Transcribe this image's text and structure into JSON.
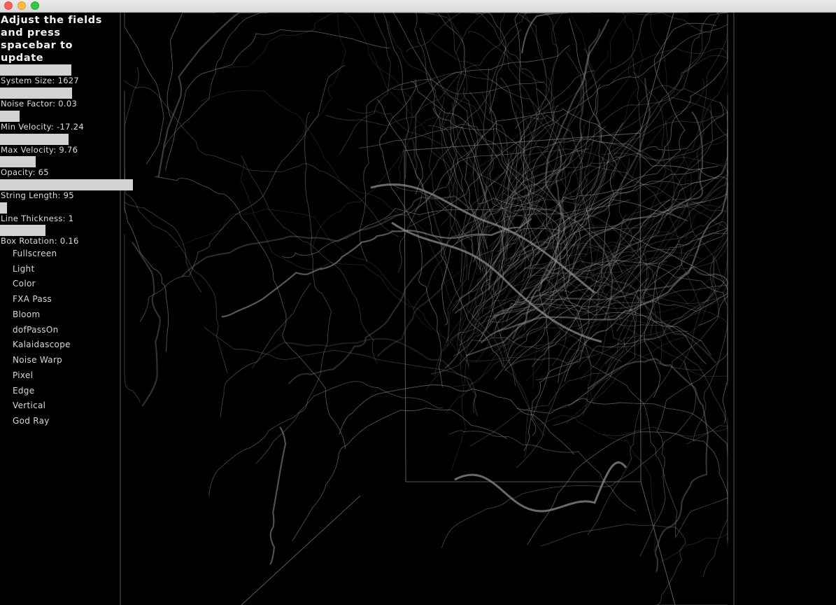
{
  "window": {
    "controls": [
      "close",
      "minimize",
      "maximize"
    ]
  },
  "panel": {
    "instructions": "Adjust the fields and press spacebar to update",
    "sliders": [
      {
        "label": "System Size: 1627",
        "fill": 0.536
      },
      {
        "label": "Noise Factor: 0.03",
        "fill": 0.542
      },
      {
        "label": "Min Velocity: -17.24",
        "fill": 0.147
      },
      {
        "label": "Max Velocity: 9.76",
        "fill": 0.516
      },
      {
        "label": "Opacity: 65",
        "fill": 0.268
      },
      {
        "label": "String Length: 95",
        "fill": 1.0
      },
      {
        "label": "Line Thickness: 1",
        "fill": 0.053
      },
      {
        "label": "Box Rotation: 0.16",
        "fill": 0.342
      }
    ],
    "toggles": [
      "Fullscreen",
      "Light",
      "Color",
      "FXA Pass",
      "Bloom",
      "dofPassOn",
      "Kalaidascope",
      "Noise Warp",
      "Pixel",
      "Edge",
      "Vertical",
      "God Ray"
    ]
  },
  "colors": {
    "background": "#000000",
    "slider": "#d2d2d2",
    "text": "#dedede",
    "strands": "#8c8c8c",
    "box": "#5a5a5a"
  }
}
